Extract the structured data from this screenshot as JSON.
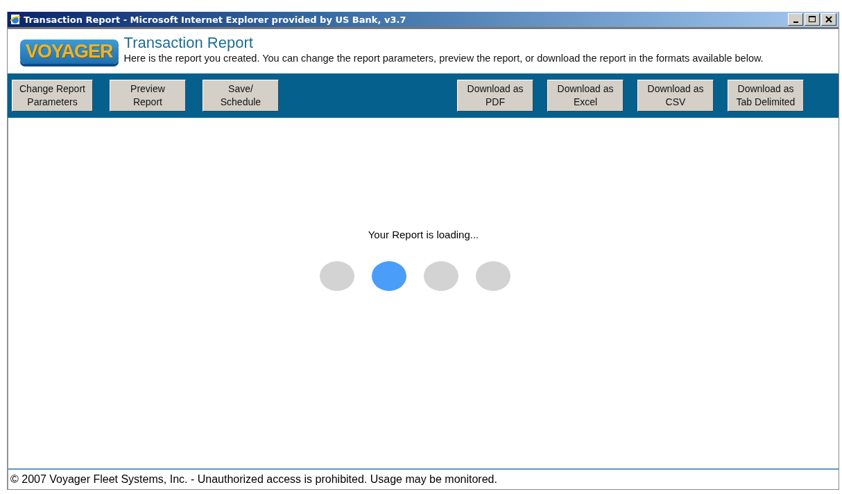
{
  "window": {
    "title": "Transaction Report - Microsoft Internet Explorer provided by US Bank, v3.7"
  },
  "header": {
    "logo": "VOYAGER",
    "title": "Transaction Report",
    "description": "Here is the report you created. You can change the report parameters, preview the report, or download the report in the formats available below."
  },
  "toolbar": {
    "left_buttons": [
      "Change Report\nParameters",
      "Preview\nReport",
      "Save/\nSchedule"
    ],
    "right_buttons": [
      "Download as\nPDF",
      "Download as\nExcel",
      "Download as\nCSV",
      "Download as\nTab Delimited"
    ]
  },
  "loading": {
    "message": "Your Report is loading...",
    "dots": [
      {
        "selected": false
      },
      {
        "selected": true
      },
      {
        "selected": false
      },
      {
        "selected": false
      }
    ]
  },
  "footer": "© 2007 Voyager Fleet Systems, Inc. - Unauthorized access is prohibited. Usage may be monitored."
}
